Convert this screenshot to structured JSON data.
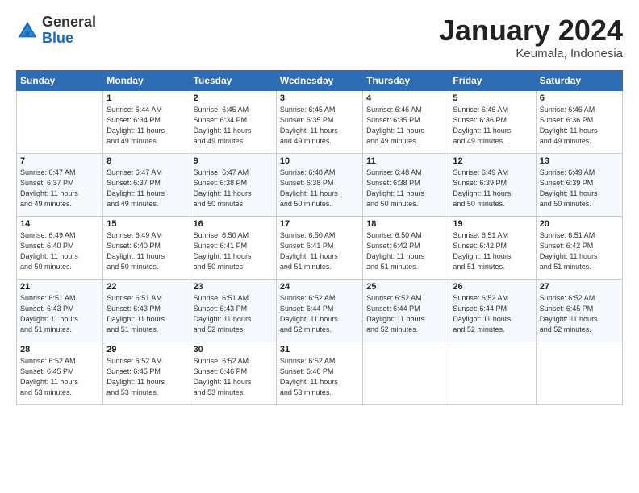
{
  "logo": {
    "general": "General",
    "blue": "Blue"
  },
  "header": {
    "title": "January 2024",
    "location": "Keumala, Indonesia"
  },
  "weekdays": [
    "Sunday",
    "Monday",
    "Tuesday",
    "Wednesday",
    "Thursday",
    "Friday",
    "Saturday"
  ],
  "weeks": [
    [
      {
        "day": "",
        "sunrise": "",
        "sunset": "",
        "daylight": ""
      },
      {
        "day": "1",
        "sunrise": "Sunrise: 6:44 AM",
        "sunset": "Sunset: 6:34 PM",
        "daylight": "Daylight: 11 hours and 49 minutes."
      },
      {
        "day": "2",
        "sunrise": "Sunrise: 6:45 AM",
        "sunset": "Sunset: 6:34 PM",
        "daylight": "Daylight: 11 hours and 49 minutes."
      },
      {
        "day": "3",
        "sunrise": "Sunrise: 6:45 AM",
        "sunset": "Sunset: 6:35 PM",
        "daylight": "Daylight: 11 hours and 49 minutes."
      },
      {
        "day": "4",
        "sunrise": "Sunrise: 6:46 AM",
        "sunset": "Sunset: 6:35 PM",
        "daylight": "Daylight: 11 hours and 49 minutes."
      },
      {
        "day": "5",
        "sunrise": "Sunrise: 6:46 AM",
        "sunset": "Sunset: 6:36 PM",
        "daylight": "Daylight: 11 hours and 49 minutes."
      },
      {
        "day": "6",
        "sunrise": "Sunrise: 6:46 AM",
        "sunset": "Sunset: 6:36 PM",
        "daylight": "Daylight: 11 hours and 49 minutes."
      }
    ],
    [
      {
        "day": "7",
        "sunrise": "Sunrise: 6:47 AM",
        "sunset": "Sunset: 6:37 PM",
        "daylight": "Daylight: 11 hours and 49 minutes."
      },
      {
        "day": "8",
        "sunrise": "Sunrise: 6:47 AM",
        "sunset": "Sunset: 6:37 PM",
        "daylight": "Daylight: 11 hours and 49 minutes."
      },
      {
        "day": "9",
        "sunrise": "Sunrise: 6:47 AM",
        "sunset": "Sunset: 6:38 PM",
        "daylight": "Daylight: 11 hours and 50 minutes."
      },
      {
        "day": "10",
        "sunrise": "Sunrise: 6:48 AM",
        "sunset": "Sunset: 6:38 PM",
        "daylight": "Daylight: 11 hours and 50 minutes."
      },
      {
        "day": "11",
        "sunrise": "Sunrise: 6:48 AM",
        "sunset": "Sunset: 6:38 PM",
        "daylight": "Daylight: 11 hours and 50 minutes."
      },
      {
        "day": "12",
        "sunrise": "Sunrise: 6:49 AM",
        "sunset": "Sunset: 6:39 PM",
        "daylight": "Daylight: 11 hours and 50 minutes."
      },
      {
        "day": "13",
        "sunrise": "Sunrise: 6:49 AM",
        "sunset": "Sunset: 6:39 PM",
        "daylight": "Daylight: 11 hours and 50 minutes."
      }
    ],
    [
      {
        "day": "14",
        "sunrise": "Sunrise: 6:49 AM",
        "sunset": "Sunset: 6:40 PM",
        "daylight": "Daylight: 11 hours and 50 minutes."
      },
      {
        "day": "15",
        "sunrise": "Sunrise: 6:49 AM",
        "sunset": "Sunset: 6:40 PM",
        "daylight": "Daylight: 11 hours and 50 minutes."
      },
      {
        "day": "16",
        "sunrise": "Sunrise: 6:50 AM",
        "sunset": "Sunset: 6:41 PM",
        "daylight": "Daylight: 11 hours and 50 minutes."
      },
      {
        "day": "17",
        "sunrise": "Sunrise: 6:50 AM",
        "sunset": "Sunset: 6:41 PM",
        "daylight": "Daylight: 11 hours and 51 minutes."
      },
      {
        "day": "18",
        "sunrise": "Sunrise: 6:50 AM",
        "sunset": "Sunset: 6:42 PM",
        "daylight": "Daylight: 11 hours and 51 minutes."
      },
      {
        "day": "19",
        "sunrise": "Sunrise: 6:51 AM",
        "sunset": "Sunset: 6:42 PM",
        "daylight": "Daylight: 11 hours and 51 minutes."
      },
      {
        "day": "20",
        "sunrise": "Sunrise: 6:51 AM",
        "sunset": "Sunset: 6:42 PM",
        "daylight": "Daylight: 11 hours and 51 minutes."
      }
    ],
    [
      {
        "day": "21",
        "sunrise": "Sunrise: 6:51 AM",
        "sunset": "Sunset: 6:43 PM",
        "daylight": "Daylight: 11 hours and 51 minutes."
      },
      {
        "day": "22",
        "sunrise": "Sunrise: 6:51 AM",
        "sunset": "Sunset: 6:43 PM",
        "daylight": "Daylight: 11 hours and 51 minutes."
      },
      {
        "day": "23",
        "sunrise": "Sunrise: 6:51 AM",
        "sunset": "Sunset: 6:43 PM",
        "daylight": "Daylight: 11 hours and 52 minutes."
      },
      {
        "day": "24",
        "sunrise": "Sunrise: 6:52 AM",
        "sunset": "Sunset: 6:44 PM",
        "daylight": "Daylight: 11 hours and 52 minutes."
      },
      {
        "day": "25",
        "sunrise": "Sunrise: 6:52 AM",
        "sunset": "Sunset: 6:44 PM",
        "daylight": "Daylight: 11 hours and 52 minutes."
      },
      {
        "day": "26",
        "sunrise": "Sunrise: 6:52 AM",
        "sunset": "Sunset: 6:44 PM",
        "daylight": "Daylight: 11 hours and 52 minutes."
      },
      {
        "day": "27",
        "sunrise": "Sunrise: 6:52 AM",
        "sunset": "Sunset: 6:45 PM",
        "daylight": "Daylight: 11 hours and 52 minutes."
      }
    ],
    [
      {
        "day": "28",
        "sunrise": "Sunrise: 6:52 AM",
        "sunset": "Sunset: 6:45 PM",
        "daylight": "Daylight: 11 hours and 53 minutes."
      },
      {
        "day": "29",
        "sunrise": "Sunrise: 6:52 AM",
        "sunset": "Sunset: 6:45 PM",
        "daylight": "Daylight: 11 hours and 53 minutes."
      },
      {
        "day": "30",
        "sunrise": "Sunrise: 6:52 AM",
        "sunset": "Sunset: 6:46 PM",
        "daylight": "Daylight: 11 hours and 53 minutes."
      },
      {
        "day": "31",
        "sunrise": "Sunrise: 6:52 AM",
        "sunset": "Sunset: 6:46 PM",
        "daylight": "Daylight: 11 hours and 53 minutes."
      },
      {
        "day": "",
        "sunrise": "",
        "sunset": "",
        "daylight": ""
      },
      {
        "day": "",
        "sunrise": "",
        "sunset": "",
        "daylight": ""
      },
      {
        "day": "",
        "sunrise": "",
        "sunset": "",
        "daylight": ""
      }
    ]
  ]
}
